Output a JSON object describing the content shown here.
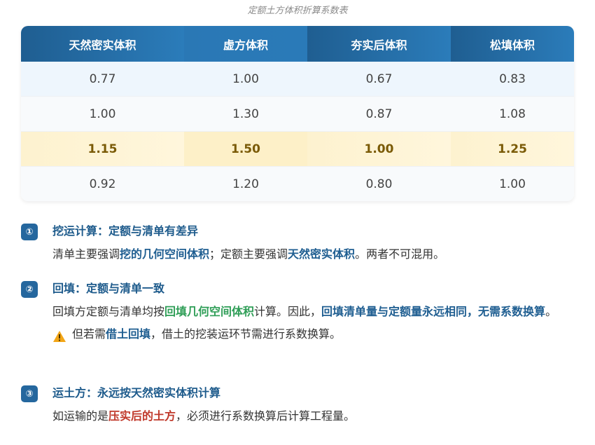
{
  "caption": "定额土方体积折算系数表",
  "table": {
    "headers": [
      "天然密实体积",
      "虚方体积",
      "夯实后体积",
      "松填体积"
    ],
    "rows": [
      [
        "0.77",
        "1.00",
        "0.67",
        "0.83"
      ],
      [
        "1.00",
        "1.30",
        "0.87",
        "1.08"
      ],
      [
        "1.15",
        "1.50",
        "1.00",
        "1.25"
      ],
      [
        "0.92",
        "1.20",
        "0.80",
        "1.00"
      ]
    ],
    "highlight_row": 2,
    "header_color": "#25679e",
    "highlight_color": "#fdf2cf"
  },
  "notes": [
    {
      "badge": "①",
      "title": "挖运计算：定额与清单有差异",
      "body": [
        {
          "t": "清单主要强调"
        },
        {
          "t": "挖的几何空间体积",
          "s": "blue"
        },
        {
          "t": "；定额主要强调"
        },
        {
          "t": "天然密实体积",
          "s": "blue"
        },
        {
          "t": "。两者不可混用。"
        }
      ]
    },
    {
      "badge": "②",
      "title": "回填：定额与清单一致",
      "body": [
        {
          "t": "回填方定额与清单均按"
        },
        {
          "t": "回填几何空间体积",
          "s": "green"
        },
        {
          "t": "计算。因此，"
        },
        {
          "t": "回填清单量与定额量永远相同，无需系数换算",
          "s": "blue"
        },
        {
          "t": "。"
        }
      ],
      "warning": [
        {
          "t": "但若需"
        },
        {
          "t": "借土回填",
          "s": "blue"
        },
        {
          "t": "，借土的挖装运环节需进行系数换算。"
        }
      ]
    },
    {
      "badge": "③",
      "title": "运土方：永远按天然密实体积计算",
      "body": [
        {
          "t": "如运输的是"
        },
        {
          "t": "压实后的土方",
          "s": "red"
        },
        {
          "t": "，必须进行系数换算后计算工程量。"
        }
      ]
    }
  ],
  "icons": {
    "warning": "warning-triangle-icon"
  }
}
